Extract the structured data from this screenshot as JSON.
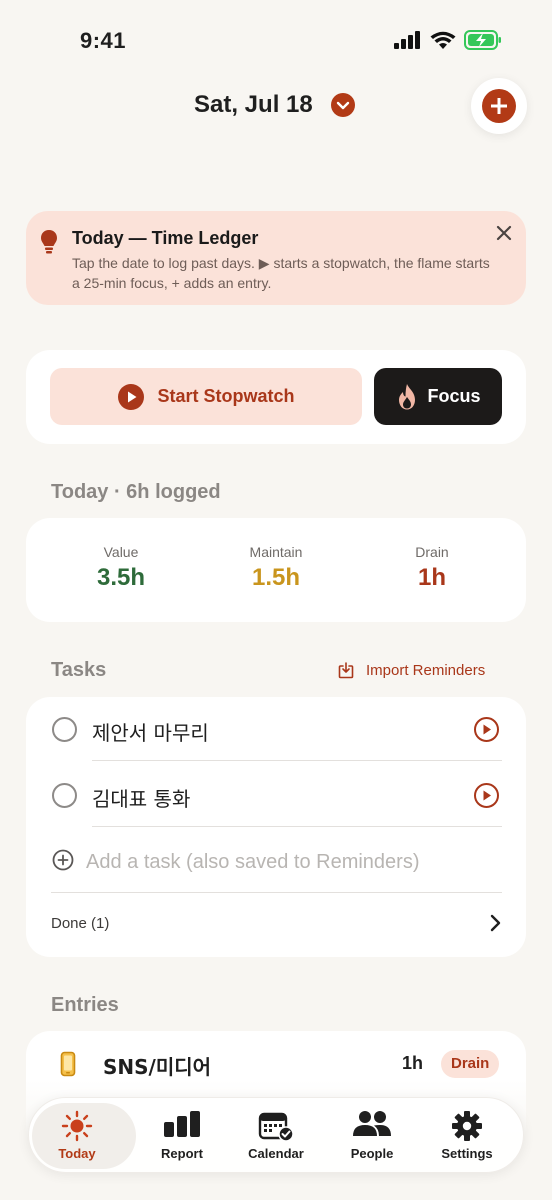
{
  "status_bar": {
    "time": "9:41"
  },
  "header": {
    "date": "Sat, Jul 18"
  },
  "tip": {
    "title": "Today — Time Ledger",
    "text": "Tap the date to log past days. ▶ starts a stopwatch, the flame starts a 25-min focus, + adds an entry."
  },
  "actions": {
    "stopwatch_label": "Start Stopwatch",
    "focus_label": "Focus"
  },
  "summary": {
    "title": "Today · 6h logged",
    "stats": [
      {
        "label": "Value",
        "value": "3.5h",
        "color": "#2e6b3a"
      },
      {
        "label": "Maintain",
        "value": "1.5h",
        "color": "#c9951d"
      },
      {
        "label": "Drain",
        "value": "1h",
        "color": "#a9371a"
      }
    ]
  },
  "tasks": {
    "title": "Tasks",
    "import_label": "Import Reminders",
    "items": [
      {
        "label": "제안서 마무리"
      },
      {
        "label": "김대표 통화"
      }
    ],
    "add_placeholder": "Add a task (also saved to Reminders)",
    "done_label": "Done (1)"
  },
  "entries": {
    "title": "Entries",
    "items": [
      {
        "icon": "phone-icon",
        "label": "SNS/미디어",
        "duration": "1h",
        "category": "Drain"
      }
    ]
  },
  "tabbar": {
    "tabs": [
      {
        "label": "Today",
        "icon": "sun-icon",
        "active": true
      },
      {
        "label": "Report",
        "icon": "bar-chart-icon",
        "active": false
      },
      {
        "label": "Calendar",
        "icon": "calendar-check-icon",
        "active": false
      },
      {
        "label": "People",
        "icon": "people-icon",
        "active": false
      },
      {
        "label": "Settings",
        "icon": "gear-icon",
        "active": false
      }
    ]
  },
  "colors": {
    "accent": "#b23a16",
    "accent_soft": "#fbe2d9",
    "background": "#f8f6f2",
    "value": "#2e6b3a",
    "maintain": "#c9951d",
    "drain": "#a9371a"
  }
}
